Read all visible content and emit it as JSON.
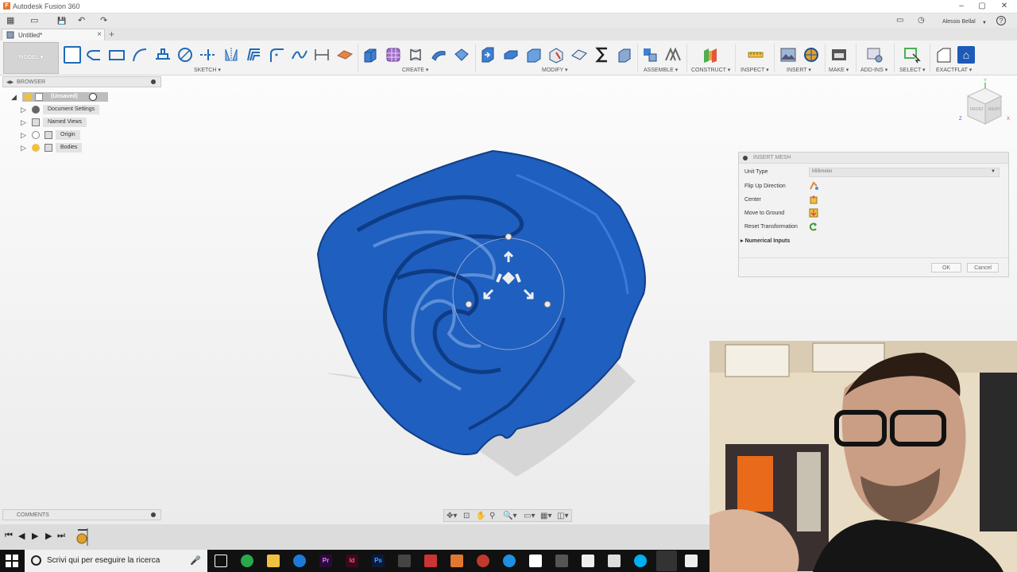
{
  "app": {
    "title": "Autodesk Fusion 360",
    "logo_letter": "F",
    "user": "Alessio Bellal",
    "help": "?"
  },
  "qat": {
    "grid": "▦",
    "file": "▭",
    "save": "💾",
    "undo": "↶",
    "redo": "↷"
  },
  "document": {
    "tab_label": "Untitled*",
    "close": "×",
    "new_tab": "+"
  },
  "toolbar": {
    "workspace": "MODEL",
    "groups": [
      "SKETCH",
      "CREATE",
      "MODIFY",
      "ASSEMBLE",
      "CONSTRUCT",
      "INSPECT",
      "INSERT",
      "MAKE",
      "ADD-INS",
      "SELECT",
      "EXACTFLAT"
    ]
  },
  "browser": {
    "title": "BROWSER",
    "root": "(Unsaved)",
    "items": [
      "Document Settings",
      "Named Views",
      "Origin",
      "Bodies"
    ]
  },
  "viewcube": {
    "front": "FRONT",
    "right": "RIGHT",
    "x": "X",
    "y": "Y",
    "z": "Z"
  },
  "insert_mesh": {
    "title": "INSERT MESH",
    "unit_type_label": "Unit Type",
    "unit_type_value": "Millimeter",
    "flip_up_label": "Flip Up Direction",
    "center_label": "Center",
    "move_to_ground_label": "Move to Ground",
    "reset_transformation_label": "Reset Transformation",
    "numerical_inputs_label": "Numerical Inputs",
    "ok_label": "OK",
    "cancel_label": "Cancel"
  },
  "comments": {
    "title": "COMMENTS"
  },
  "timeline": {
    "first": "⏮",
    "prev": "◀",
    "play": "▶",
    "next": "▶",
    "last": "⏭"
  },
  "taskbar": {
    "search_placeholder": "Scrivi qui per eseguire la ricerca"
  },
  "colors": {
    "mesh_blue": "#1f5fbf",
    "toolbar_bg": "#f3f3f3",
    "taskbar_bg": "#111111"
  }
}
